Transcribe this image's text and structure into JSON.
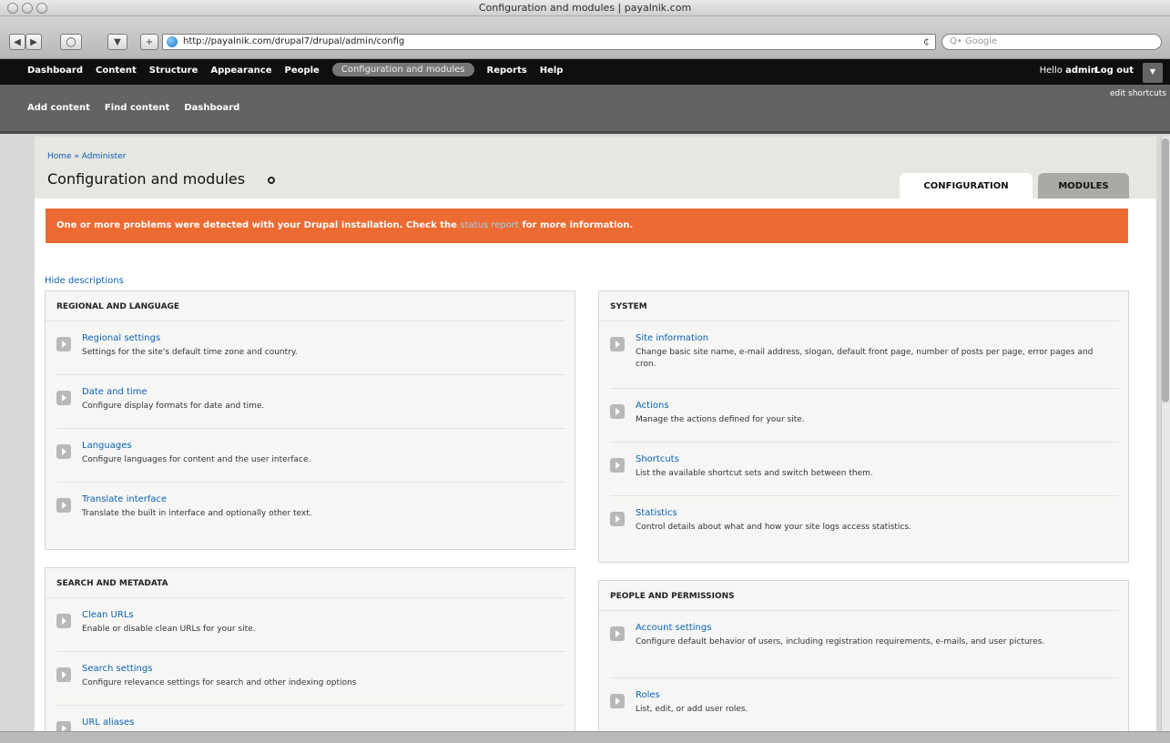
{
  "window": {
    "title": "Configuration and modules | payalnik.com"
  },
  "browser": {
    "url": "http://payalnik.com/drupal7/drupal/admin/config",
    "search_placeholder": "Q• Google",
    "add_btn": "+",
    "reload": "¢"
  },
  "toolbar": {
    "nav": [
      "Dashboard",
      "Content",
      "Structure",
      "Appearance",
      "People",
      "Configuration and modules",
      "Reports",
      "Help"
    ],
    "active": "Configuration and modules",
    "hello": "Hello",
    "username": "admin",
    "logout": "Log out",
    "edit_shortcuts": "edit shortcuts",
    "shortcuts": [
      "Add content",
      "Find content",
      "Dashboard"
    ]
  },
  "header": {
    "breadcrumb": "Home » Administer",
    "title": "Configuration and modules",
    "tabs": [
      "CONFIGURATION",
      "MODULES"
    ]
  },
  "warning": {
    "text_before": "One or more problems were detected with your Drupal installation. Check the ",
    "link": "status report",
    "text_after": " for more information."
  },
  "hide_descriptions": "Hide descriptions",
  "panels": {
    "regional": {
      "title": "REGIONAL AND LANGUAGE",
      "items": [
        {
          "title": "Regional settings",
          "desc": "Settings for the site's default time zone and country."
        },
        {
          "title": "Date and time",
          "desc": "Configure display formats for date and time."
        },
        {
          "title": "Languages",
          "desc": "Configure languages for content and the user interface."
        },
        {
          "title": "Translate interface",
          "desc": "Translate the built in interface and optionally other text."
        }
      ]
    },
    "search": {
      "title": "SEARCH AND METADATA",
      "items": [
        {
          "title": "Clean URLs",
          "desc": "Enable or disable clean URLs for your site."
        },
        {
          "title": "Search settings",
          "desc": "Configure relevance settings for search and other indexing options"
        },
        {
          "title": "URL aliases",
          "desc": ""
        }
      ]
    },
    "system": {
      "title": "SYSTEM",
      "items": [
        {
          "title": "Site information",
          "desc": "Change basic site name, e-mail address, slogan, default front page, number of posts per page, error pages and cron."
        },
        {
          "title": "Actions",
          "desc": "Manage the actions defined for your site."
        },
        {
          "title": "Shortcuts",
          "desc": "List the available shortcut sets and switch between them."
        },
        {
          "title": "Statistics",
          "desc": "Control details about what and how your site logs access statistics."
        }
      ]
    },
    "people": {
      "title": "PEOPLE AND PERMISSIONS",
      "items": [
        {
          "title": "Account settings",
          "desc": "Configure default behavior of users, including registration requirements, e-mails, and user pictures."
        },
        {
          "title": "Roles",
          "desc": "List, edit, or add user roles."
        }
      ]
    }
  }
}
